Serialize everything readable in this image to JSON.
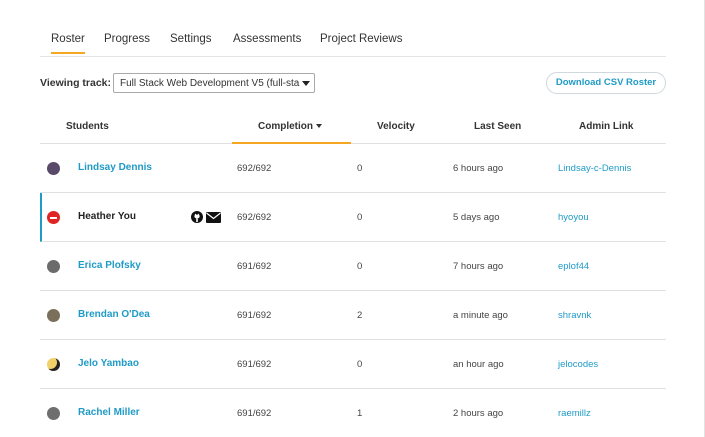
{
  "tabs": [
    {
      "label": "Roster",
      "active": true
    },
    {
      "label": "Progress",
      "active": false
    },
    {
      "label": "Settings",
      "active": false
    },
    {
      "label": "Assessments",
      "active": false
    },
    {
      "label": "Project Reviews",
      "active": false
    }
  ],
  "track": {
    "label": "Viewing track:",
    "selected": "Full Stack Web Development V5 (full-sta"
  },
  "download_button": "Download CSV Roster",
  "columns": {
    "students": "Students",
    "completion": "Completion",
    "velocity": "Velocity",
    "last_seen": "Last Seen",
    "admin_link": "Admin Link"
  },
  "students": [
    {
      "name": "Lindsay Dennis",
      "completion": "692/692",
      "velocity": "0",
      "last_seen": "6 hours ago",
      "admin_link": "Lindsay-c-Dennis",
      "avatar_color": "#5a4a6a",
      "name_is_link": true
    },
    {
      "name": "Heather You",
      "completion": "692/692",
      "velocity": "0",
      "last_seen": "5 days ago",
      "admin_link": "hyoyou",
      "avatar_color": "#e02424",
      "name_is_link": false,
      "icons": [
        "github-icon",
        "mail-icon"
      ]
    },
    {
      "name": "Erica Plofsky",
      "completion": "691/692",
      "velocity": "0",
      "last_seen": "7 hours ago",
      "admin_link": "eplof44",
      "avatar_color": "#6b6b6b",
      "name_is_link": true
    },
    {
      "name": "Brendan O'Dea",
      "completion": "691/692",
      "velocity": "2",
      "last_seen": "a minute ago",
      "admin_link": "shravnk",
      "avatar_color": "#7a6f5a",
      "name_is_link": true
    },
    {
      "name": "Jelo Yambao",
      "completion": "691/692",
      "velocity": "0",
      "last_seen": "an hour ago",
      "admin_link": "jelocodes",
      "avatar_color": "#f2d16b",
      "name_is_link": true
    },
    {
      "name": "Rachel Miller",
      "completion": "691/692",
      "velocity": "1",
      "last_seen": "2 hours ago",
      "admin_link": "raemillz",
      "avatar_color": "#6e6e6e",
      "name_is_link": true
    }
  ]
}
